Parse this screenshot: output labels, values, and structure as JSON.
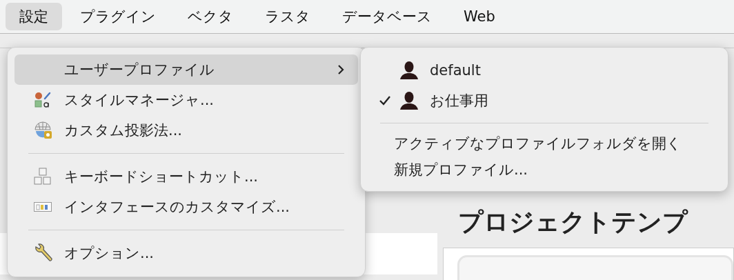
{
  "menubar": [
    {
      "label": "設定",
      "selected": true
    },
    {
      "label": "プラグイン",
      "selected": false
    },
    {
      "label": "ベクタ",
      "selected": false
    },
    {
      "label": "ラスタ",
      "selected": false
    },
    {
      "label": "データベース",
      "selected": false
    },
    {
      "label": "Web",
      "selected": false
    }
  ],
  "settings_menu": [
    {
      "kind": "item",
      "label": "ユーザープロファイル",
      "selected": true,
      "submenu": true
    },
    {
      "kind": "item",
      "label": "スタイルマネージャ...",
      "selected": false,
      "submenu": false
    },
    {
      "kind": "item",
      "label": "カスタム投影法...",
      "selected": false,
      "submenu": false
    },
    {
      "kind": "separator"
    },
    {
      "kind": "item",
      "label": "キーボードショートカット...",
      "selected": false,
      "submenu": false
    },
    {
      "kind": "item",
      "label": "インタフェースのカスタマイズ...",
      "selected": false,
      "submenu": false
    },
    {
      "kind": "separator"
    },
    {
      "kind": "item",
      "label": "オプション...",
      "selected": false,
      "submenu": false
    }
  ],
  "profiles_submenu": [
    {
      "kind": "profile",
      "label": "default",
      "checked": false
    },
    {
      "kind": "profile",
      "label": "お仕事用",
      "checked": true
    },
    {
      "kind": "separator"
    },
    {
      "kind": "action",
      "label": "アクティブなプロファイルフォルダを開く"
    },
    {
      "kind": "action",
      "label": "新規プロファイル..."
    }
  ],
  "background_heading": "プロジェクトテンプ"
}
